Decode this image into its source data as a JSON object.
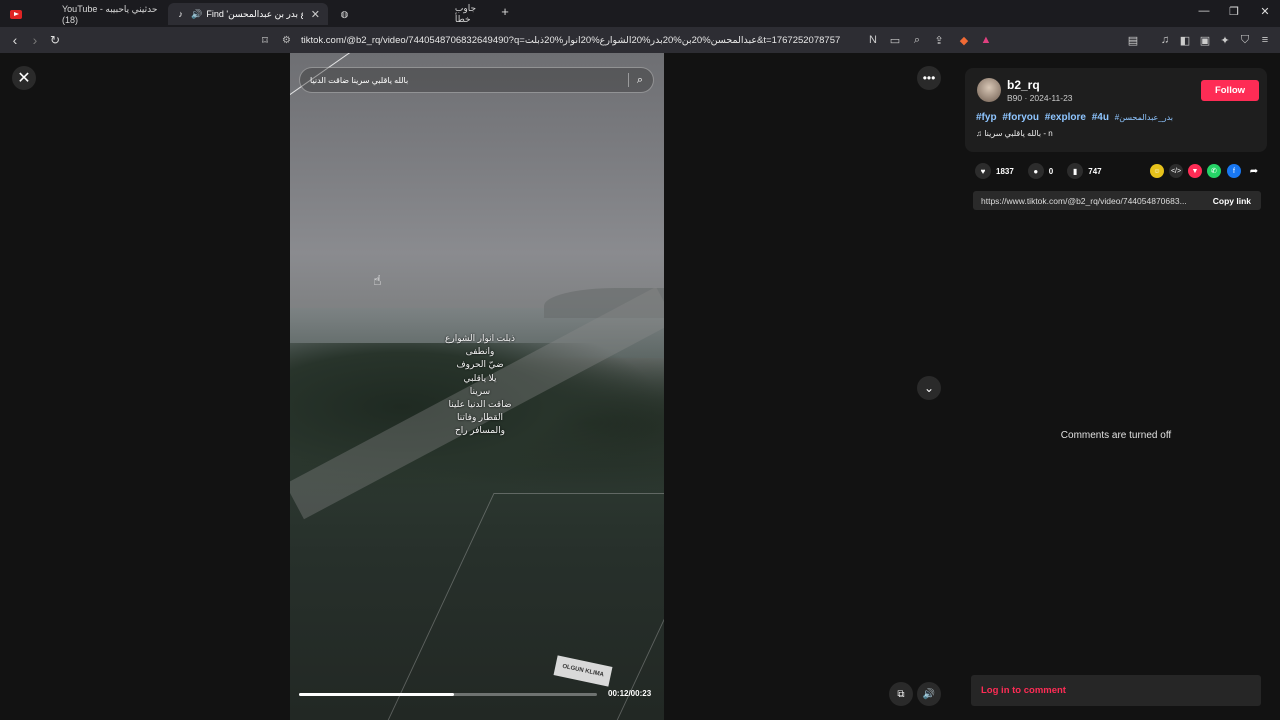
{
  "browser": {
    "tabs": [
      {
        "title": "YouTube - حدثيني ياحبيبه (18)",
        "icon": "youtube-icon"
      },
      {
        "title": "Find 'الشوارع بدر بن عبدالمحسن'",
        "icon": "tiktok-icon"
      },
      {
        "title": "جاوب خطأ",
        "icon": "globe-icon"
      }
    ],
    "new_tab": "+",
    "url": "tiktok.com/@b2_rq/video/7440548706832649490?q=عبدالمحسن%20بن%20بدر%20الشوارع%20انوار%20ذبلت&t=1767252078757"
  },
  "video": {
    "search_text": "بالله ياقلبي سرينا ضاقت الدنيا",
    "lyrics": [
      "ذبلت انوار الشوارع",
      "وانطفى",
      "ضيّ الحروف",
      "يلا ياقلبي",
      "سرينا",
      "ضاقت الدنيا علينا",
      "القطار وفاتنا",
      "والمسافر راح"
    ],
    "sign_text": "OLGUN KLIMA",
    "progress_fraction": 0.52,
    "time": "00:12/00:23"
  },
  "author": {
    "username": "b2_rq",
    "meta": "B90 · 2024-11-23",
    "follow_label": "Follow",
    "hashtags": [
      "#fyp",
      "#foryou",
      "#explore",
      "#4u"
    ],
    "hashtag_ar": "#بدر_عبدالمحسن",
    "music": "بالله ياقلبي سرينا - n"
  },
  "stats": {
    "likes": "1837",
    "comments": "0",
    "saves": "747"
  },
  "share": {
    "link": "https://www.tiktok.com/@b2_rq/video/744054870683...",
    "copy_label": "Copy link"
  },
  "comments": {
    "off_text": "Comments are turned off",
    "login_label": "Log in to comment"
  },
  "colors": {
    "accent": "#fe2c55",
    "hashtag": "#8ec5ff"
  }
}
